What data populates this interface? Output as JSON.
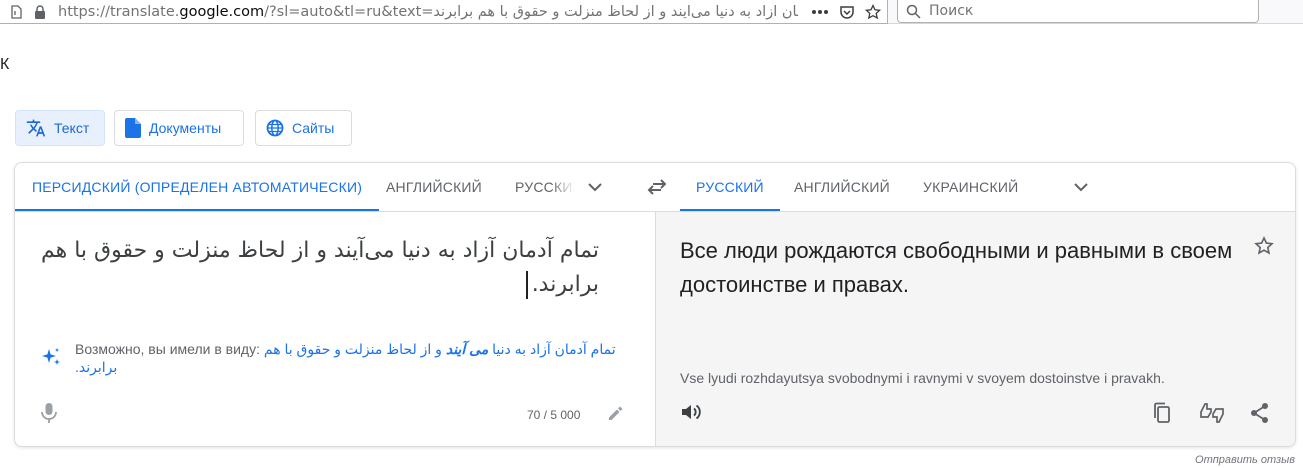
{
  "browser": {
    "url_prefix": "https://translate.",
    "url_domain": "google.com",
    "url_rest": "/?sl=auto&tl=ru&text=تمام آدمان آزاد به دنیا می‌آیند و از لحاظ منزلت و حقوق با هم برابرند",
    "search_placeholder": "Поиск"
  },
  "left_edge_char": "К",
  "modes": [
    {
      "label": "Текст",
      "icon": "translate-icon",
      "active": true
    },
    {
      "label": "Документы",
      "icon": "document-icon",
      "active": false
    },
    {
      "label": "Сайты",
      "icon": "globe-icon",
      "active": false
    }
  ],
  "source_langs": [
    {
      "label": "ПЕРСИДСКИЙ (ОПРЕДЕЛЕН АВТОМАТИЧЕСКИ)",
      "active": true
    },
    {
      "label": "АНГЛИЙСКИЙ",
      "active": false
    },
    {
      "label": "РУССКИЙ",
      "active": false
    }
  ],
  "target_langs": [
    {
      "label": "РУССКИЙ",
      "active": true
    },
    {
      "label": "АНГЛИЙСКИЙ",
      "active": false
    },
    {
      "label": "УКРАИНСКИЙ",
      "active": false
    }
  ],
  "source": {
    "text": "تمام آدمان آزاد به دنیا می‌آیند و از لحاظ منزلت و حقوق با هم برابرند.",
    "suggestion_prefix": "Возможно, вы имели в виду: ",
    "suggestion_before": "تمام آدمان آزاد به دنیا ",
    "suggestion_bold": "می آیند",
    "suggestion_after": " و از لحاظ منزلت و حقوق با هم برابرند.",
    "char_count": "70 / 5 000"
  },
  "target": {
    "text": "Все люди рождаются свободными и равными в своем достоинстве и правах.",
    "transliteration": "Vse lyudi rozhdayutsya svobodnymi i ravnymi v svoyem dostoinstve i pravakh."
  },
  "feedback_label": "Отправить отзыв",
  "colors": {
    "accent": "#1a73e8",
    "active_bg": "#e8f0fe",
    "target_bg": "#f5f5f5"
  }
}
